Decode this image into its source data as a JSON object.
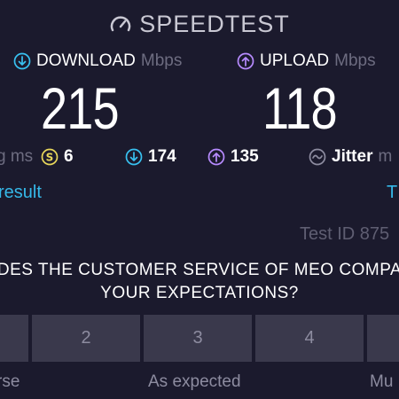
{
  "header": {
    "title": "SPEEDTEST",
    "icon": "speedometer-icon"
  },
  "download": {
    "label": "DOWNLOAD",
    "unit": "Mbps",
    "value": "215",
    "icon": "download-arrow-icon",
    "color": "#38c1f0"
  },
  "upload": {
    "label": "UPLOAD",
    "unit": "Mbps",
    "value": "118",
    "icon": "upload-arrow-icon",
    "color": "#b78bff"
  },
  "ping": {
    "ms_label": "g ms",
    "idle_value": "6",
    "download_latency": "174",
    "upload_latency": "135",
    "jitter_label": "Jitter",
    "jitter_unit": "m"
  },
  "links": {
    "result": "result",
    "right": "T"
  },
  "test_id": "Test ID 875",
  "question": {
    "line1": "DES THE CUSTOMER SERVICE OF MEO COMPA",
    "line2": "YOUR EXPECTATIONS?"
  },
  "rating": {
    "options": [
      "",
      "2",
      "3",
      "4",
      ""
    ],
    "captions": {
      "low": "rse",
      "mid": "As expected",
      "high": "Mu"
    }
  },
  "colors": {
    "background": "#1b1a2d",
    "accent_link": "#35b8e8",
    "idle_yellow": "#e8d75a",
    "button": "#3a394c"
  }
}
